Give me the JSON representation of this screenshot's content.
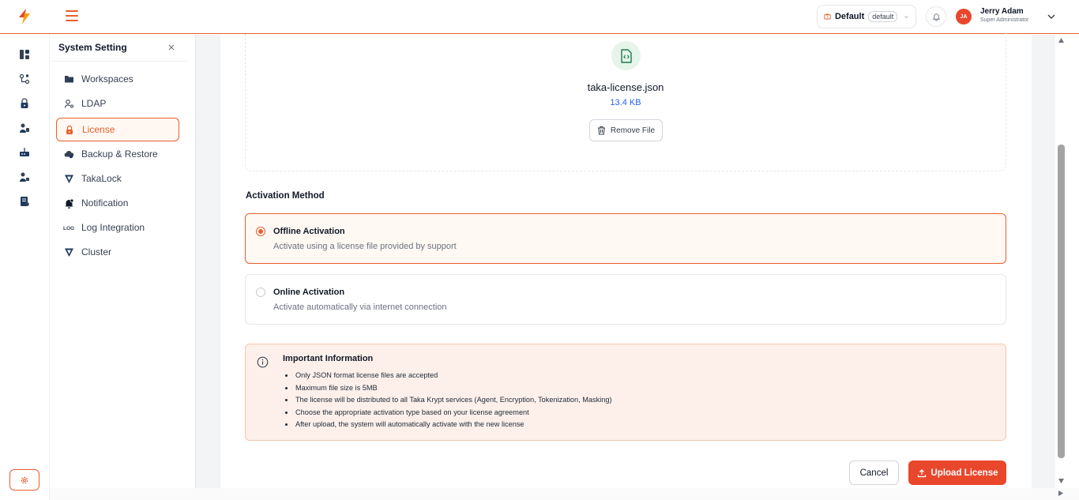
{
  "header": {
    "workspace": {
      "name": "Default",
      "tag": "default"
    },
    "user": {
      "initials": "JA",
      "name": "Jerry Adam",
      "role": "Super Administrator"
    }
  },
  "rail": {
    "icons": [
      "dashboard-icon",
      "key-flow-icon",
      "lock-icon",
      "user-group-icon",
      "server-icon",
      "user-admin-icon",
      "document-icon"
    ],
    "settings_icon": "gear-icon"
  },
  "sidebar": {
    "title": "System Setting",
    "items": [
      {
        "label": "Workspaces",
        "icon": "folder-icon"
      },
      {
        "label": "LDAP",
        "icon": "user-key-icon"
      },
      {
        "label": "License",
        "icon": "lock-icon",
        "active": true
      },
      {
        "label": "Backup & Restore",
        "icon": "cloud-icon"
      },
      {
        "label": "TakaLock",
        "icon": "takalock-icon"
      },
      {
        "label": "Notification",
        "icon": "bell-icon"
      },
      {
        "label": "Log Integration",
        "icon": "log-icon"
      },
      {
        "label": "Cluster",
        "icon": "cluster-icon"
      }
    ]
  },
  "upload": {
    "file_name": "taka-license.json",
    "file_size": "13.4 KB",
    "remove_label": "Remove File"
  },
  "activation": {
    "title": "Activation Method",
    "options": [
      {
        "title": "Offline Activation",
        "description": "Activate using a license file provided by support",
        "selected": true
      },
      {
        "title": "Online Activation",
        "description": "Activate automatically via internet connection",
        "selected": false
      }
    ]
  },
  "info": {
    "title": "Important Information",
    "items": [
      "Only JSON format license files are accepted",
      "Maximum file size is 5MB",
      "The license will be distributed to all Taka Krypt services (Agent, Encryption, Tokenization, Masking)",
      "Choose the appropriate activation type based on your license agreement",
      "After upload, the system will automatically activate with the new license"
    ]
  },
  "actions": {
    "cancel_label": "Cancel",
    "upload_label": "Upload License"
  },
  "colors": {
    "accent": "#e8602c",
    "primary_button": "#e8472c",
    "info_bg": "#fdf0ea",
    "file_icon": "#1e7a4a"
  }
}
